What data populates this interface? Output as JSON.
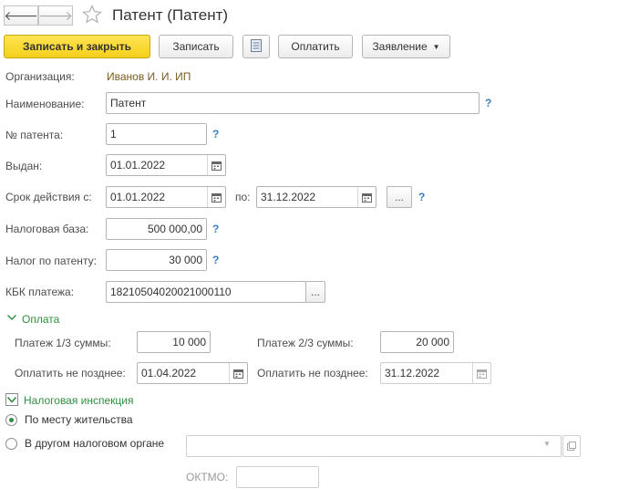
{
  "header": {
    "title": "Патент (Патент)",
    "back_icon": "arrow-left-icon",
    "forward_icon": "arrow-right-icon",
    "favorite_icon": "star-icon"
  },
  "toolbar": {
    "save_close_label": "Записать и закрыть",
    "save_label": "Записать",
    "report_icon": "list-report-icon",
    "pay_label": "Оплатить",
    "statement_label": "Заявление"
  },
  "form": {
    "organization": {
      "label": "Организация:",
      "value": "Иванов И. И. ИП"
    },
    "name": {
      "label": "Наименование:",
      "value": "Патент"
    },
    "patent_number": {
      "label": "№ патента:",
      "value": "1"
    },
    "issued": {
      "label": "Выдан:",
      "value": "01.01.2022"
    },
    "validity": {
      "label": "Срок действия с:",
      "from": "01.01.2022",
      "to_label": "по:",
      "to": "31.12.2022",
      "more_label": "..."
    },
    "tax_base": {
      "label": "Налоговая база:",
      "value": "500 000,00"
    },
    "tax_amount": {
      "label": "Налог по патенту:",
      "value": "30 000"
    },
    "kbk": {
      "label": "КБК платежа:",
      "value": "18210504020021000110",
      "more_label": "..."
    },
    "help_mark": "?"
  },
  "payment": {
    "title": "Оплата",
    "part1": {
      "label": "Платеж 1/3 суммы:",
      "value": "10 000",
      "due_label": "Оплатить не позднее:",
      "due": "01.04.2022"
    },
    "part2": {
      "label": "Платеж 2/3 суммы:",
      "value": "20 000",
      "due_label": "Оплатить не позднее:",
      "due": "31.12.2022"
    }
  },
  "inspection": {
    "title": "Налоговая инспекция",
    "checked": true,
    "option_residence": "По месту жительства",
    "option_other": "В другом налоговом органе",
    "selected": "По месту жительства",
    "other_value": "",
    "oktmo_label": "ОКТМО:",
    "oktmo_value": ""
  },
  "colors": {
    "accent_green": "#2f8f3e",
    "primary_button": "#f5cf1c",
    "help_blue": "#3a7fbf",
    "org_link": "#7a5a1e"
  }
}
